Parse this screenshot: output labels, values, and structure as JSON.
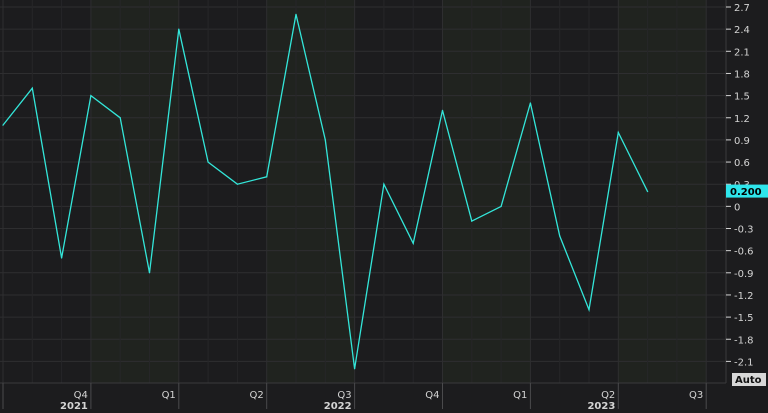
{
  "colors": {
    "background": "#1c1c1e",
    "grid": "#2e2e30",
    "line": "#33e6d9",
    "text": "#d4d4d4",
    "last_value_bg": "#2ee6ec",
    "last_value_text": "#000000",
    "auto_button_bg": "#d7d7d7",
    "auto_button_text": "#111111"
  },
  "auto_button": {
    "label": "Auto"
  },
  "last_value_label": "0.200",
  "chart_data": {
    "type": "line",
    "title": "",
    "xlabel": "",
    "ylabel": "",
    "grid": true,
    "ylim": [
      -2.3,
      2.75
    ],
    "y_ticks": [
      {
        "value": 2.7,
        "label": "2.7"
      },
      {
        "value": 2.4,
        "label": "2.4"
      },
      {
        "value": 2.1,
        "label": "2.1"
      },
      {
        "value": 1.8,
        "label": "1.8"
      },
      {
        "value": 1.5,
        "label": "1.5"
      },
      {
        "value": 1.2,
        "label": "1.2"
      },
      {
        "value": 0.9,
        "label": "0.9"
      },
      {
        "value": 0.6,
        "label": "0.6"
      },
      {
        "value": 0.3,
        "label": "0.3"
      },
      {
        "value": 0.0,
        "label": "0"
      },
      {
        "value": -0.3,
        "label": "-0.3"
      },
      {
        "value": -0.6,
        "label": "-0.6"
      },
      {
        "value": -0.9,
        "label": "-0.9"
      },
      {
        "value": -1.2,
        "label": "-1.2"
      },
      {
        "value": -1.5,
        "label": "-1.5"
      },
      {
        "value": -1.8,
        "label": "-1.8"
      },
      {
        "value": -2.1,
        "label": "-2.1"
      }
    ],
    "x_ticks": [
      {
        "month_index": 0,
        "label": "Q3",
        "year_label": ""
      },
      {
        "month_index": 3,
        "label": "Q4",
        "year_label": "2021"
      },
      {
        "month_index": 6,
        "label": "Q1",
        "year_label": ""
      },
      {
        "month_index": 9,
        "label": "Q2",
        "year_label": ""
      },
      {
        "month_index": 12,
        "label": "Q3",
        "year_label": "2022"
      },
      {
        "month_index": 15,
        "label": "Q4",
        "year_label": ""
      },
      {
        "month_index": 18,
        "label": "Q1",
        "year_label": ""
      },
      {
        "month_index": 21,
        "label": "Q2",
        "year_label": "2023"
      },
      {
        "month_index": 24,
        "label": "Q3",
        "year_label": ""
      }
    ],
    "series": [
      {
        "x": [
          0,
          1,
          2,
          3,
          4,
          5,
          6,
          7,
          8,
          9,
          10,
          11,
          12,
          13,
          14,
          15,
          16,
          17,
          18,
          19,
          20,
          21,
          22
        ],
        "values": [
          1.1,
          1.6,
          -0.7,
          1.5,
          1.2,
          -0.9,
          2.4,
          0.6,
          0.3,
          0.4,
          2.6,
          0.9,
          -2.2,
          0.3,
          -0.5,
          1.3,
          -0.2,
          0.0,
          1.4,
          -0.4,
          -1.4,
          1.0,
          0.2
        ]
      }
    ]
  }
}
